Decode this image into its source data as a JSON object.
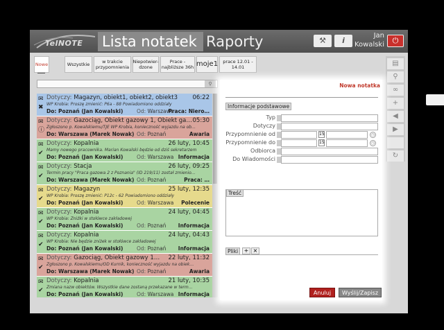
{
  "app": {
    "logo_text": "TelNOTE",
    "tabs": [
      "Lista notatek",
      "Raporty"
    ],
    "user": {
      "first": "Jan",
      "last": "Kowalski"
    },
    "icons": {
      "tools": "wrench-icon",
      "info": "info-icon",
      "power": "power-icon"
    }
  },
  "toolbar": {
    "add_label": "+",
    "filters": [
      {
        "label": "Nowe",
        "active": true
      },
      {
        "label": "Wszystkie"
      },
      {
        "label": "w trakcie przypomnienia"
      },
      {
        "label": "Niepotwier- dzone"
      },
      {
        "label": "Prace - najbliższe 36h"
      },
      {
        "label": "moje1",
        "big": true
      },
      {
        "label": "prace 12.01 - 14.01"
      }
    ]
  },
  "search": {
    "placeholder": "",
    "value": ""
  },
  "notes": [
    {
      "bg": "#a9c6e8",
      "icons": [
        "envelope",
        "x"
      ],
      "dotyczy": "Dotyczy:",
      "subject": "Magazyn, obiekt1, obiekt2, obiekt3",
      "date": "06:22",
      "text": "WP Krobia:  Proszę zmienić: P6a - 88  Powiadomiono oddziały",
      "do": "Do: Poznań (Jan Kowalski)",
      "od_label": "Od:",
      "od": "Warszawa",
      "cat": "Praca: Niero…",
      "cat_color": "#222"
    },
    {
      "bg": "#d9a49b",
      "icons": [
        "envelope",
        "!"
      ],
      "dotyczy": "Dotyczy:",
      "subject": "Gazociąg, Obiekt gazowy 1, Obiekt ga…",
      "date": "05:30",
      "text": "Zgłoszono p. Kowalskiemu/TJE WP Krobia, konieczność wyjazdu na ob…",
      "do": "Do: Warszawa (Marek Nowak)",
      "od_label": "Od:",
      "od": "Poznań",
      "cat": "Awaria",
      "cat_color": "#222"
    },
    {
      "bg": "#a9d4a2",
      "icons": [
        "envelope-open",
        "check"
      ],
      "dotyczy": "Dotyczy:",
      "subject": "Kopalnia",
      "date": "26 luty, 10:45",
      "text": "Mamy nowego pracownika. Marian Kowalski będzie od dziś sekretarzem",
      "do": "Do: Poznań (Jan Kowalski)",
      "od_label": "Od:",
      "od": "Warszawa",
      "cat": "Informacja",
      "cat_color": "#222"
    },
    {
      "bg": "#a9d4a2",
      "icons": [
        "envelope-open",
        "check"
      ],
      "dotyczy": "Dotyczy:",
      "subject": "Stacja",
      "date": "26 luty, 09:25",
      "text": "Termin pracy \"Praca gazowa 2 z Poznania\" (ID 219/11) został zmienio…",
      "do": "Do: Warszawa (Marek Nowak)",
      "od_label": "Od:",
      "od": "Poznań",
      "cat": "Praca: …",
      "cat_color": "#222"
    },
    {
      "bg": "#e6da8c",
      "icons": [
        "envelope-open",
        "check"
      ],
      "dotyczy": "Dotyczy:",
      "subject": "Magazyn",
      "date": "25 luty, 12:35",
      "text": "WP Krobia:  Proszę zmienić: P12c - 62  Powiadomiono oddziały",
      "do": "Do: Poznań (Jan Kowalski)",
      "od_label": "Od:",
      "od": "Warszawa",
      "cat": "Polecenie",
      "cat_color": "#222"
    },
    {
      "bg": "#a9d4a2",
      "icons": [
        "envelope-open",
        "check"
      ],
      "dotyczy": "Dotyczy:",
      "subject": "Kopalnia",
      "date": "24 luty, 04:45",
      "text": "WP Krobia:  Zniżki w stołówce zakładowej",
      "do": "Do: Poznań (Jan Kowalski)",
      "od_label": "Od:",
      "od": "Poznań",
      "cat": "Informacja",
      "cat_color": "#222"
    },
    {
      "bg": "#a9d4a2",
      "icons": [
        "envelope-open",
        "check"
      ],
      "dotyczy": "Dotyczy:",
      "subject": "Kopalnia",
      "date": "24 luty, 04:43",
      "text": "WP Krobia:  Nie będzie zniżek w stołówce zakładowej",
      "do": "Do: Poznań (Jan Kowalski)",
      "od_label": "Od:",
      "od": "Poznań",
      "cat": "Informacja",
      "cat_color": "#222"
    },
    {
      "bg": "#d9a49b",
      "icons": [
        "envelope-open",
        "check"
      ],
      "dotyczy": "Dotyczy:",
      "subject": "Gazociąg, Obiekt gazowy 1…",
      "date": "22 luty, 11:32",
      "text": "Zgłoszono p. Kowalskiemu/OD Kurnik, konieczność wyjazdu na obiek…",
      "do": "Do: Warszawa (Marek Nowak)",
      "od_label": "Od:",
      "od": "Poznań",
      "cat": "Awaria",
      "cat_color": "#222"
    },
    {
      "bg": "#a9d4a2",
      "icons": [
        "envelope-open",
        "check"
      ],
      "dotyczy": "Dotyczy:",
      "subject": "Kopalnia",
      "date": "21 luty, 10:35",
      "text": "Zmiana nazw obiektów. Wszystkie dane zostaną przekazane w term…",
      "do": "Do: Poznań (Jan Kowalski)",
      "od_label": "Od:",
      "od": "Warszawa",
      "cat": "Informacja",
      "cat_color": "#222"
    }
  ],
  "panel": {
    "tab_label": "Nowa notatka",
    "section_title": "Informacje podstawowe",
    "fields": [
      "Typ",
      "Dotyczy",
      "Przypomnienie od",
      "Przypomnienie do",
      "Odbiorca",
      "Do Wiadomości"
    ],
    "cal_label": "15",
    "tresc_title": "Treść",
    "pliki_title": "Pliki",
    "pliki_add": "+",
    "pliki_remove": "×",
    "cancel_label": "Anuluj",
    "submit_label": "Wyślij/Zapisz"
  }
}
